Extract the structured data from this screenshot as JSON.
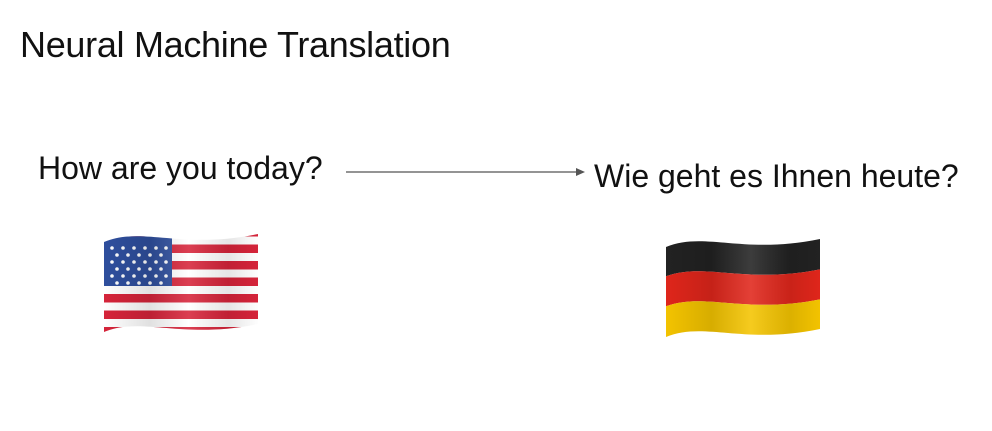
{
  "title": "Neural Machine Translation",
  "source": {
    "text": "How are you today?",
    "flag_icon": "us-flag-icon"
  },
  "target": {
    "text": "Wie geht es Ihnen heute?",
    "flag_icon": "germany-flag-icon"
  },
  "colors": {
    "text": "#111111",
    "arrow": "#555555",
    "us_red": "#d6243a",
    "us_blue": "#2f4f9e",
    "de_black": "#222222",
    "de_red": "#e0261b",
    "de_gold": "#f4c400"
  }
}
